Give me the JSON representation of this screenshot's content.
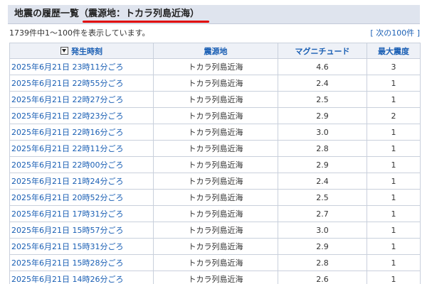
{
  "header": {
    "title": "地震の履歴一覧（震源地：トカラ列島近海）"
  },
  "summary": {
    "text": "1739件中1～100件を表示しています。",
    "next_link": "次の100件"
  },
  "table": {
    "columns": [
      "発生時刻",
      "震源地",
      "マグニチュード",
      "最大震度"
    ],
    "rows": [
      {
        "time": "2025年6月21日 23時11分ごろ",
        "epicenter": "トカラ列島近海",
        "magnitude": "4.6",
        "intensity": "3"
      },
      {
        "time": "2025年6月21日 22時55分ごろ",
        "epicenter": "トカラ列島近海",
        "magnitude": "2.4",
        "intensity": "1"
      },
      {
        "time": "2025年6月21日 22時27分ごろ",
        "epicenter": "トカラ列島近海",
        "magnitude": "2.5",
        "intensity": "1"
      },
      {
        "time": "2025年6月21日 22時23分ごろ",
        "epicenter": "トカラ列島近海",
        "magnitude": "2.9",
        "intensity": "2"
      },
      {
        "time": "2025年6月21日 22時16分ごろ",
        "epicenter": "トカラ列島近海",
        "magnitude": "3.0",
        "intensity": "1"
      },
      {
        "time": "2025年6月21日 22時11分ごろ",
        "epicenter": "トカラ列島近海",
        "magnitude": "2.8",
        "intensity": "1"
      },
      {
        "time": "2025年6月21日 22時00分ごろ",
        "epicenter": "トカラ列島近海",
        "magnitude": "2.9",
        "intensity": "1"
      },
      {
        "time": "2025年6月21日 21時24分ごろ",
        "epicenter": "トカラ列島近海",
        "magnitude": "2.4",
        "intensity": "1"
      },
      {
        "time": "2025年6月21日 20時52分ごろ",
        "epicenter": "トカラ列島近海",
        "magnitude": "2.5",
        "intensity": "1"
      },
      {
        "time": "2025年6月21日 17時31分ごろ",
        "epicenter": "トカラ列島近海",
        "magnitude": "2.7",
        "intensity": "1"
      },
      {
        "time": "2025年6月21日 15時57分ごろ",
        "epicenter": "トカラ列島近海",
        "magnitude": "3.0",
        "intensity": "1"
      },
      {
        "time": "2025年6月21日 15時31分ごろ",
        "epicenter": "トカラ列島近海",
        "magnitude": "2.9",
        "intensity": "1"
      },
      {
        "time": "2025年6月21日 15時28分ごろ",
        "epicenter": "トカラ列島近海",
        "magnitude": "2.8",
        "intensity": "1"
      },
      {
        "time": "2025年6月21日 14時26分ごろ",
        "epicenter": "トカラ列島近海",
        "magnitude": "2.6",
        "intensity": "1"
      }
    ]
  },
  "colors": {
    "link": "#1a5fb4",
    "title_bar": "#dfe4ee",
    "highlight_underline": "#e00000"
  },
  "icons": {
    "sort": "sort-descending-icon"
  }
}
